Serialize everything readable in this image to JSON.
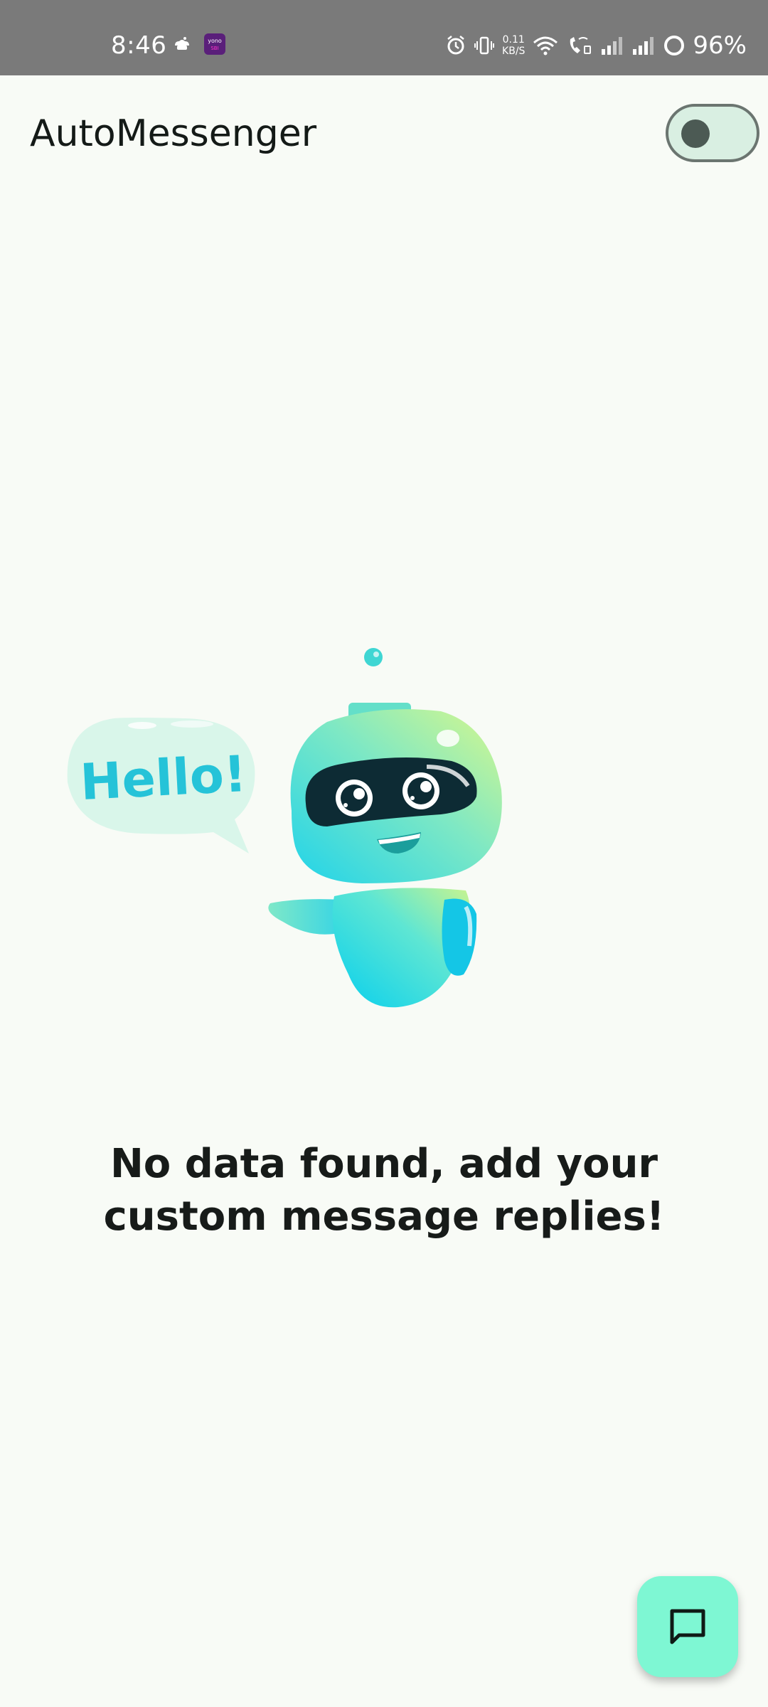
{
  "status_bar": {
    "time": "8:46",
    "netspeed_value": "0.11",
    "netspeed_unit": "KB/S",
    "battery": "96%",
    "icons": [
      "chef-icon",
      "yono-app-icon",
      "alarm-icon",
      "vibrate-icon",
      "wifi-icon",
      "wifi-calling-icon",
      "signal-icon",
      "signal-icon",
      "battery-ring-icon"
    ]
  },
  "app_bar": {
    "title": "AutoMessenger",
    "toggle_state": "off"
  },
  "illustration": {
    "speech_text": "Hello!"
  },
  "empty_state": {
    "message": "No data found, add your custom message replies!"
  },
  "fab": {
    "icon": "chat-bubble-icon"
  },
  "colors": {
    "background": "#F8FBF6",
    "fab": "#7EF7D3",
    "toggle_track": "#D9EFE2",
    "robot_teal": "#32D6E6",
    "robot_green": "#C9F58A"
  }
}
